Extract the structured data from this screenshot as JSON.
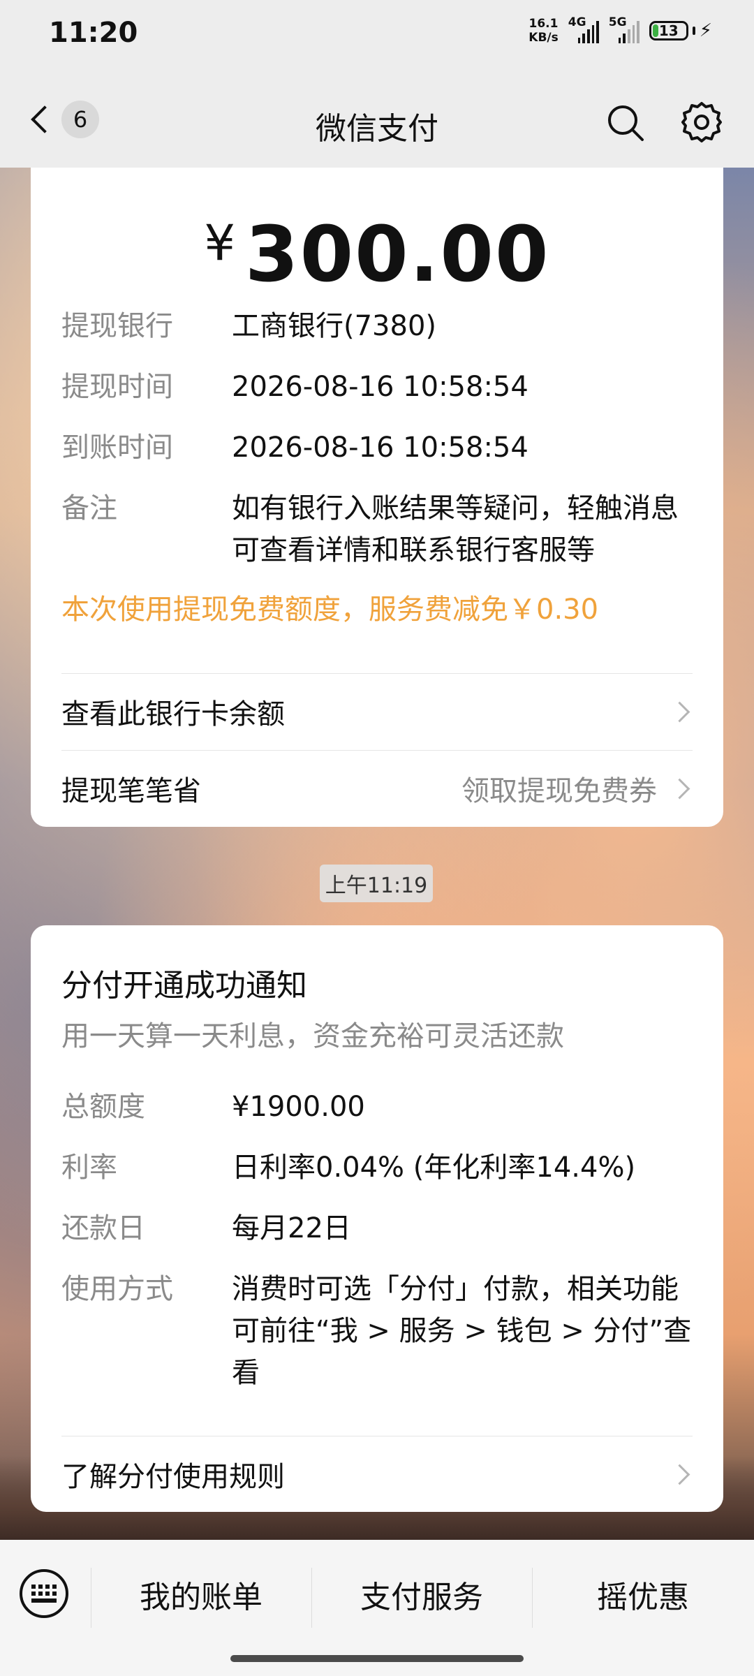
{
  "status_bar": {
    "time": "11:20",
    "net_speed_value": "16.1",
    "net_speed_unit": "KB/s",
    "signal1_label": "4G",
    "signal2_label": "5G",
    "battery": "13"
  },
  "nav": {
    "unread_count": "6",
    "title": "微信支付"
  },
  "withdrawal_card": {
    "currency": "¥",
    "amount": "300.00",
    "rows": [
      {
        "label": "提现银行",
        "value": "工商银行(7380)"
      },
      {
        "label": "提现时间",
        "value": "2026-08-16 10:58:54"
      },
      {
        "label": "到账时间",
        "value": "2026-08-16 10:58:54"
      },
      {
        "label": "备注",
        "value": "如有银行入账结果等疑问，轻触消息可查看详情和联系银行客服等"
      }
    ],
    "promo": "本次使用提现免费额度，服务费减免￥0.30",
    "link1": "查看此银行卡余额",
    "link2": "提现笔笔省",
    "link2_aside": "领取提现免费券"
  },
  "timestamp": "上午11:19",
  "fenfu_card": {
    "title": "分付开通成功通知",
    "subtitle": "用一天算一天利息，资金充裕可灵活还款",
    "rows": [
      {
        "label": "总额度",
        "value": "¥1900.00"
      },
      {
        "label": "利率",
        "value": "日利率0.04% (年化利率14.4%)"
      },
      {
        "label": "还款日",
        "value": "每月22日"
      },
      {
        "label": "使用方式",
        "value": "消费时可选「分付」付款，相关功能可前往“我 > 服务 > 钱包 > 分付”查看"
      }
    ],
    "link": "了解分付使用规则"
  },
  "bottom_menu": [
    "我的账单",
    "支付服务",
    "摇优惠"
  ]
}
